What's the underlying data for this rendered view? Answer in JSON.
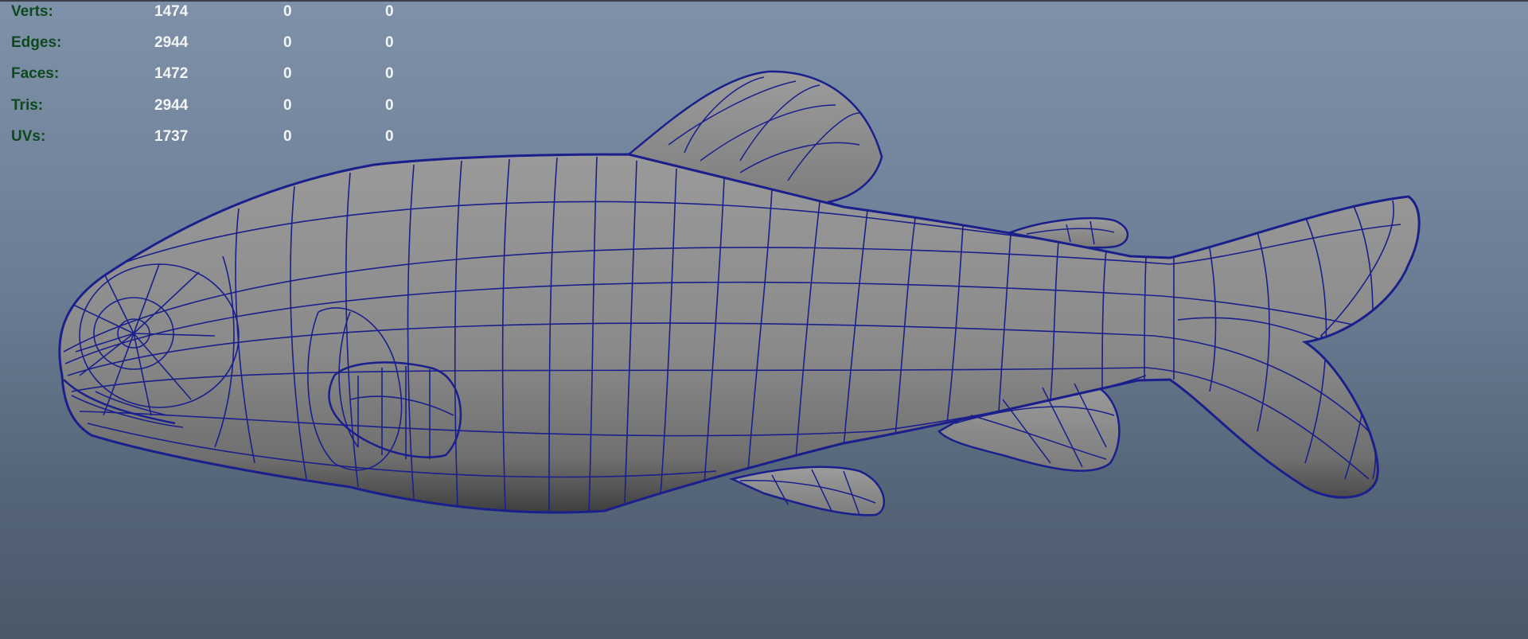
{
  "hud": {
    "rows": [
      {
        "label": "Verts:",
        "values": [
          "1474",
          "0",
          "0"
        ]
      },
      {
        "label": "Edges:",
        "values": [
          "2944",
          "0",
          "0"
        ]
      },
      {
        "label": "Faces:",
        "values": [
          "1472",
          "0",
          "0"
        ]
      },
      {
        "label": "Tris:",
        "values": [
          "2944",
          "0",
          "0"
        ]
      },
      {
        "label": "UVs:",
        "values": [
          "1737",
          "0",
          "0"
        ]
      }
    ]
  },
  "colors": {
    "label_green": "#0c4a1e",
    "value_white": "#f2f4f6",
    "wire_blue": "#1a1f8c",
    "mesh_gray": "#8c8c8c",
    "background_top": "#7f91a8",
    "background_bottom": "#4a5869"
  }
}
